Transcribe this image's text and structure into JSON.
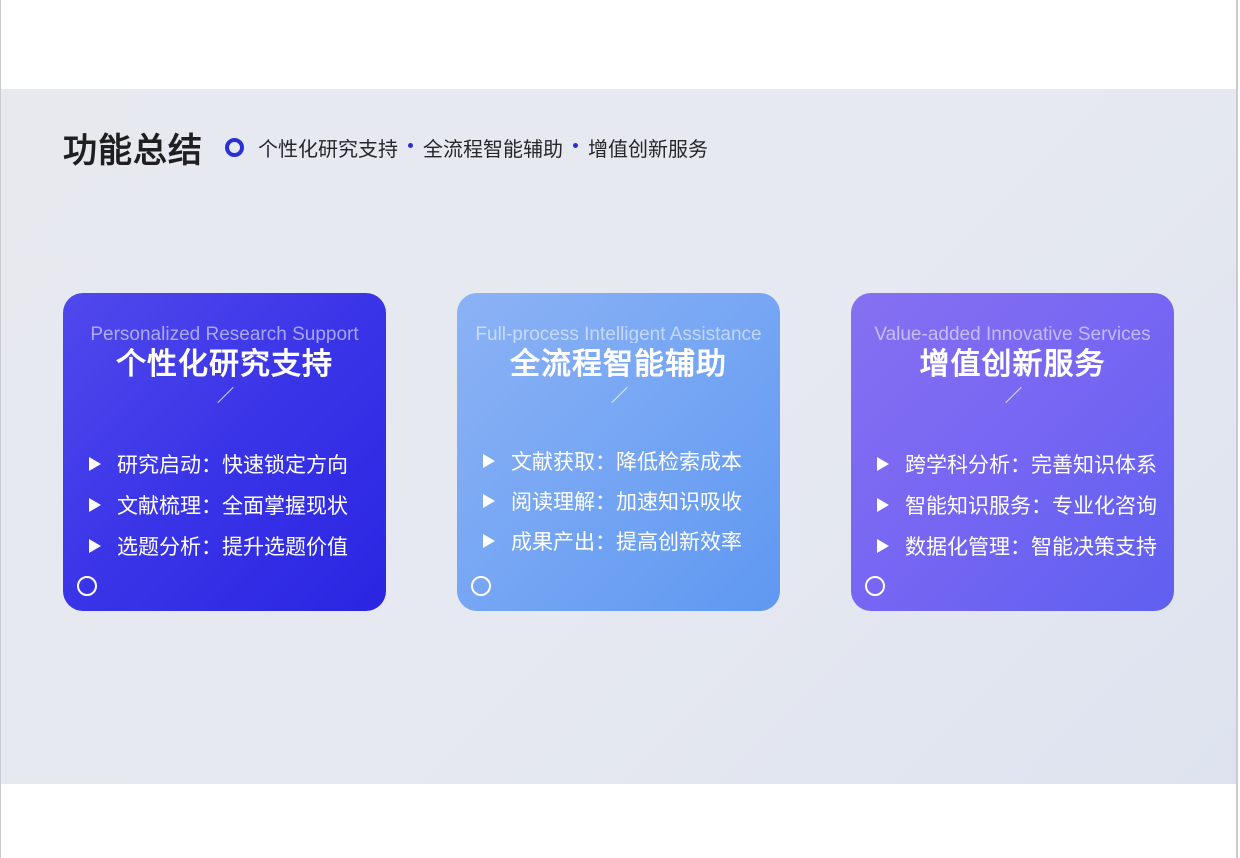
{
  "header": {
    "title": "功能总结",
    "subtitle_items": [
      "个性化研究支持",
      "全流程智能辅助",
      "增值创新服务"
    ]
  },
  "cards": [
    {
      "en": "Personalized Research Support",
      "zh": "个性化研究支持",
      "items": [
        "研究启动：快速锁定方向",
        "文献梳理：全面掌握现状",
        "选题分析：提升选题价值"
      ]
    },
    {
      "en": "Full-process Intelligent Assistance",
      "zh": "全流程智能辅助",
      "items": [
        "文献获取：降低检索成本",
        "阅读理解：加速知识吸收",
        "成果产出：提高创新效率"
      ]
    },
    {
      "en": "Value-added Innovative Services",
      "zh": "增值创新服务",
      "items": [
        "跨学科分析：完善知识体系",
        "智能知识服务：专业化咨询",
        "数据化管理：智能决策支持"
      ]
    }
  ],
  "colors": {
    "accent": "#2b2fd6",
    "card_1": "#3a34e8",
    "card_2": "#78a7f4",
    "card_3": "#7666f3"
  }
}
